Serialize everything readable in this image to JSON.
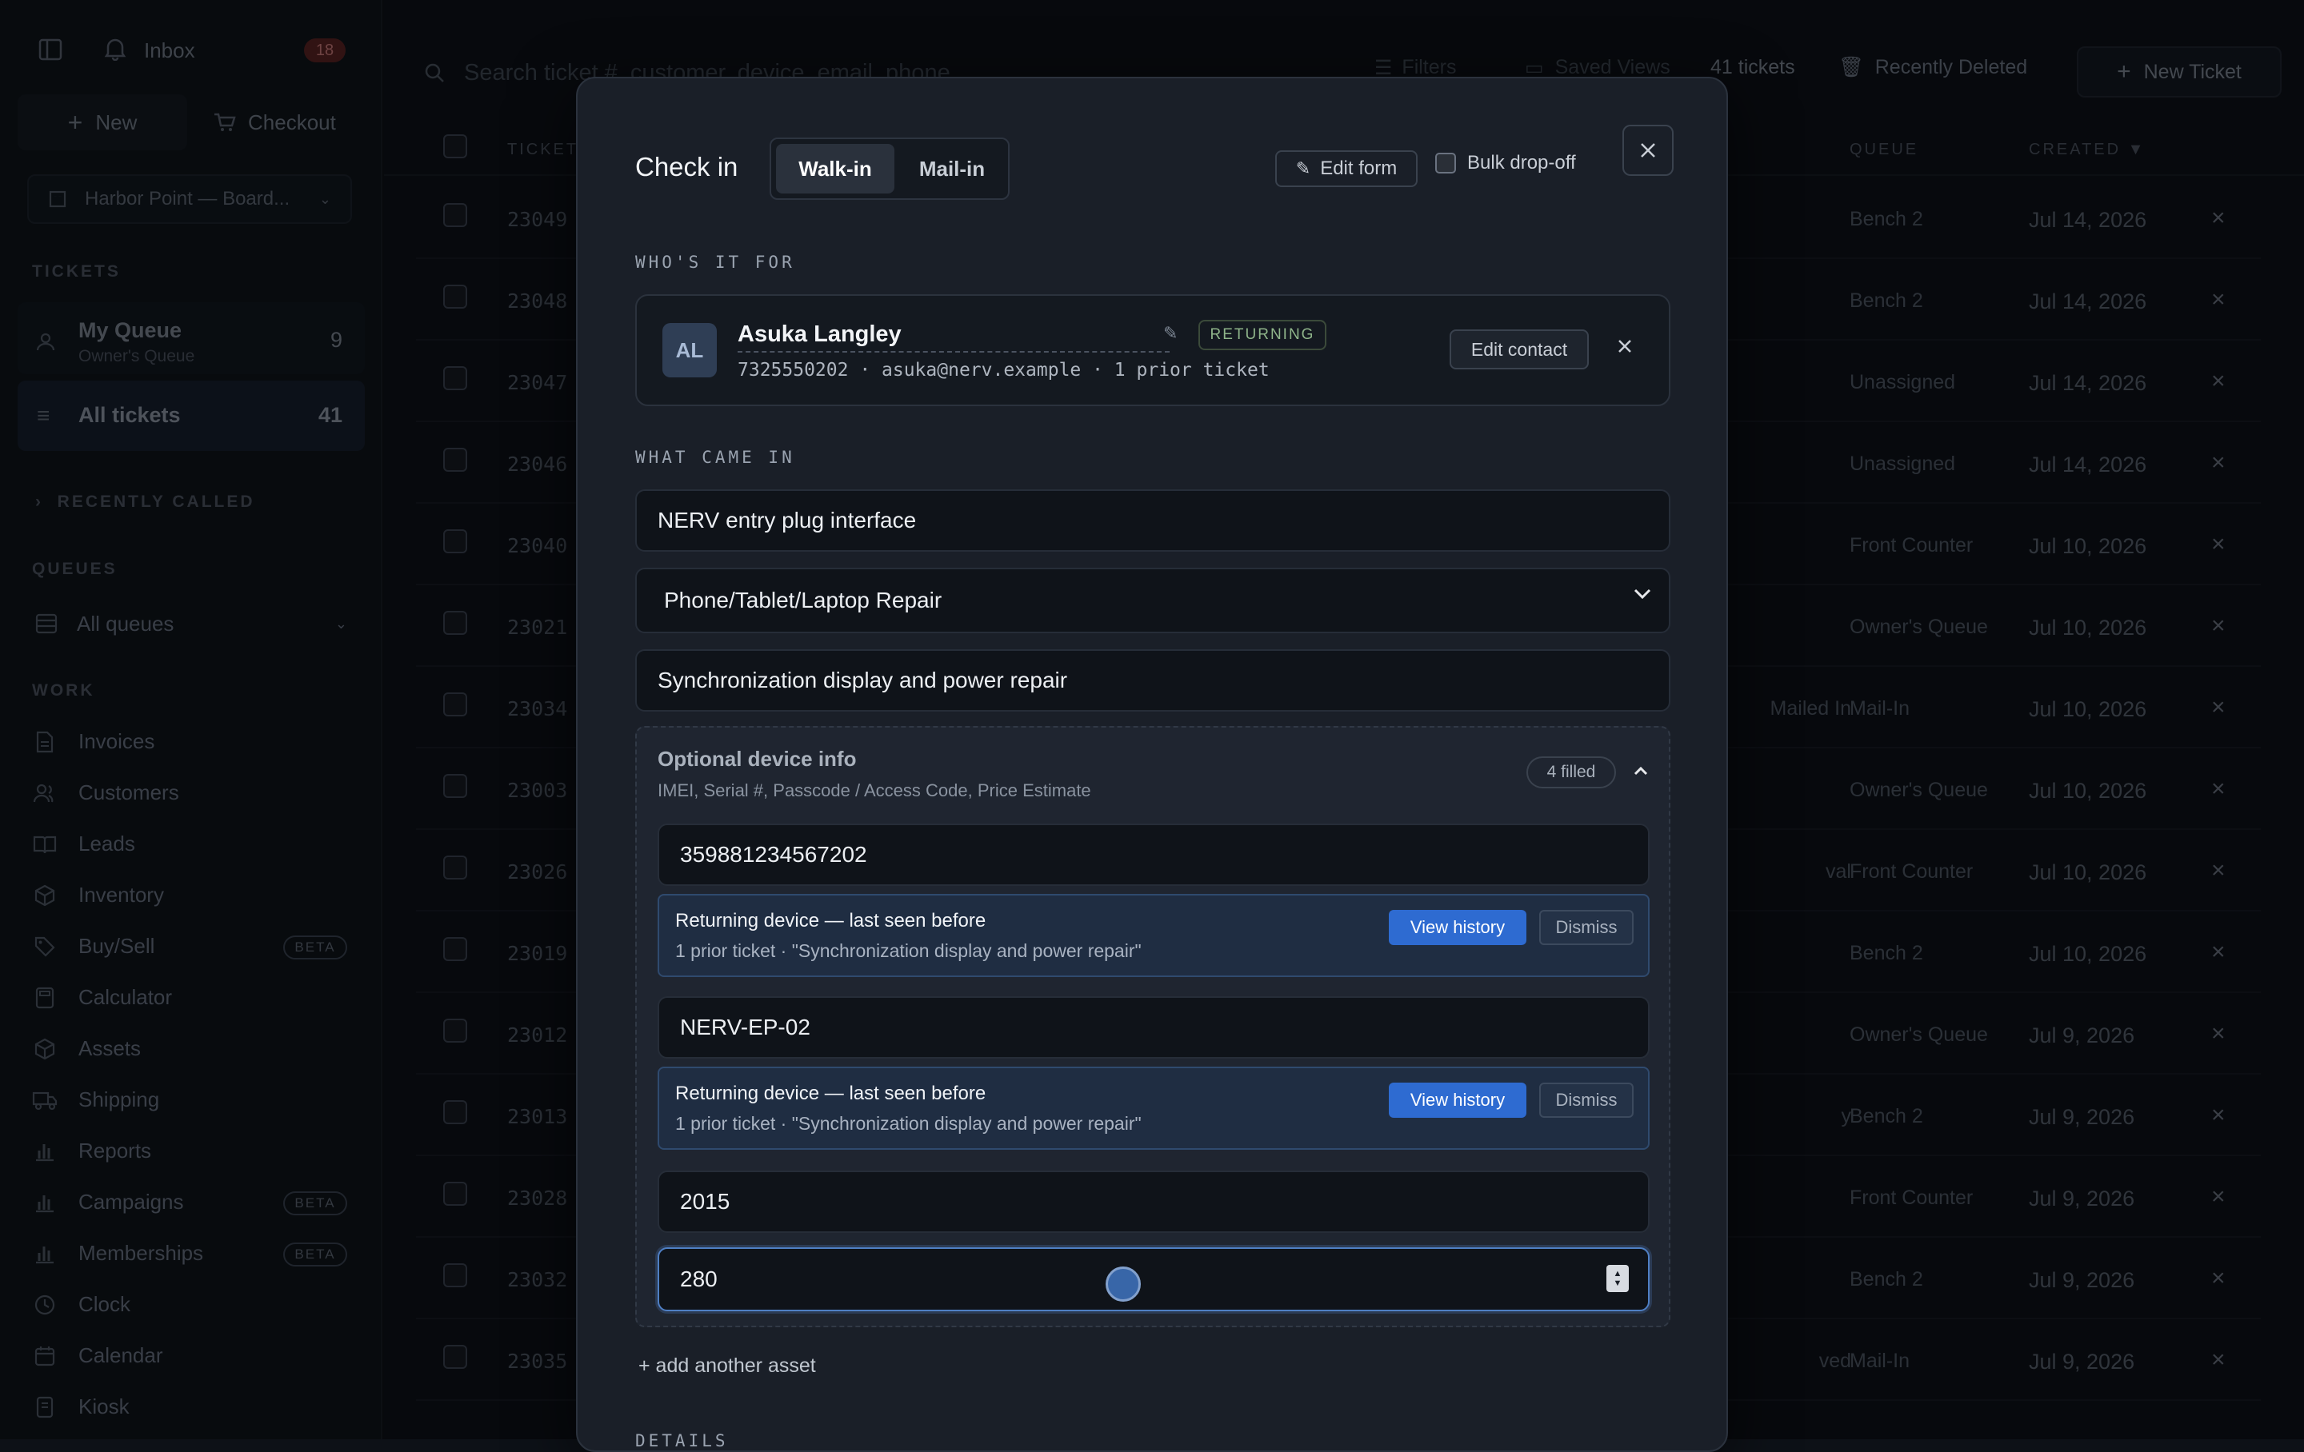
{
  "sidebar": {
    "inbox_label": "Inbox",
    "inbox_count": "18",
    "new_label": "New",
    "checkout_label": "Checkout",
    "location": "Harbor Point — Board...",
    "tickets_title": "TICKETS",
    "my_queue_label": "My Queue",
    "my_queue_sub": "Owner's Queue",
    "my_queue_count": "9",
    "all_tickets_label": "All tickets",
    "all_tickets_count": "41",
    "recently_called": "RECENTLY CALLED",
    "queues_title": "QUEUES",
    "all_queues": "All queues",
    "work_title": "WORK",
    "work_items": [
      {
        "label": "Invoices",
        "icon": "file-icon"
      },
      {
        "label": "Customers",
        "icon": "users-icon"
      },
      {
        "label": "Leads",
        "icon": "book-icon"
      },
      {
        "label": "Inventory",
        "icon": "box-icon"
      },
      {
        "label": "Buy/Sell",
        "icon": "tag-icon",
        "badge": "BETA"
      },
      {
        "label": "Calculator",
        "icon": "calculator-icon"
      },
      {
        "label": "Assets",
        "icon": "cube-icon"
      },
      {
        "label": "Shipping",
        "icon": "truck-icon"
      },
      {
        "label": "Reports",
        "icon": "bar-chart-icon"
      },
      {
        "label": "Campaigns",
        "icon": "bar-chart-icon",
        "badge": "BETA"
      },
      {
        "label": "Memberships",
        "icon": "bar-chart-icon",
        "badge": "BETA"
      },
      {
        "label": "Clock",
        "icon": "clock-icon"
      },
      {
        "label": "Calendar",
        "icon": "calendar-icon"
      },
      {
        "label": "Kiosk",
        "icon": "tablet-icon"
      }
    ]
  },
  "topbar": {
    "search_placeholder": "Search ticket #, customer, device, email, phone",
    "filters": "Filters",
    "saved_views": "Saved Views",
    "ticket_count": "41 tickets",
    "recently_deleted": "Recently Deleted",
    "new_ticket": "New Ticket"
  },
  "table": {
    "col_ticket": "TICKET",
    "col_queue": "QUEUE",
    "col_created": "CREATED ▼",
    "rows": [
      {
        "id": "23049",
        "mid": "",
        "queue": "Bench 2",
        "created": "Jul 14, 2026"
      },
      {
        "id": "23048",
        "mid": "",
        "queue": "Bench 2",
        "created": "Jul 14, 2026"
      },
      {
        "id": "23047",
        "mid": "",
        "queue": "Unassigned",
        "created": "Jul 14, 2026"
      },
      {
        "id": "23046",
        "mid": "",
        "queue": "Unassigned",
        "created": "Jul 14, 2026"
      },
      {
        "id": "23040",
        "mid": "",
        "queue": "Front Counter",
        "created": "Jul 10, 2026"
      },
      {
        "id": "23021",
        "mid": "",
        "queue": "Owner's Queue",
        "created": "Jul 10, 2026"
      },
      {
        "id": "23034",
        "mid": "Mailed In",
        "queue": "Mail-In",
        "created": "Jul 10, 2026"
      },
      {
        "id": "23003",
        "mid": "",
        "queue": "Owner's Queue",
        "created": "Jul 10, 2026"
      },
      {
        "id": "23026",
        "mid": "val",
        "queue": "Front Counter",
        "created": "Jul 10, 2026"
      },
      {
        "id": "23019",
        "mid": "",
        "queue": "Bench 2",
        "created": "Jul 10, 2026"
      },
      {
        "id": "23012",
        "mid": "",
        "queue": "Owner's Queue",
        "created": "Jul 9, 2026"
      },
      {
        "id": "23013",
        "mid": "y",
        "queue": "Bench 2",
        "created": "Jul 9, 2026"
      },
      {
        "id": "23028",
        "mid": "",
        "queue": "Front Counter",
        "created": "Jul 9, 2026"
      },
      {
        "id": "23032",
        "mid": "",
        "queue": "Bench 2",
        "created": "Jul 9, 2026"
      },
      {
        "id": "23035",
        "mid": "ved",
        "queue": "Mail-In",
        "created": "Jul 9, 2026"
      }
    ]
  },
  "modal": {
    "title": "Check in",
    "tab_walkin": "Walk-in",
    "tab_mailin": "Mail-in",
    "edit_form": "Edit form",
    "bulk_dropoff": "Bulk drop-off",
    "whos_it_for": "WHO'S IT FOR",
    "customer": {
      "initials": "AL",
      "name": "Asuka Langley",
      "badge": "RETURNING",
      "details": "7325550202 · asuka@nerv.example · 1 prior ticket",
      "edit_contact": "Edit contact"
    },
    "what_came_in": "WHAT CAME IN",
    "device_name": "NERV entry plug interface",
    "category": "Phone/Tablet/Laptop Repair",
    "issue": "Synchronization display and power repair",
    "optional": {
      "title": "Optional device info",
      "subtitle": "IMEI, Serial #, Passcode / Access Code, Price Estimate",
      "filled": "4 filled",
      "imei": "359881234567202",
      "serial": "NERV-EP-02",
      "passcode": "2015",
      "price": "280"
    },
    "alert": {
      "title": "Returning device — last seen before",
      "sub": "1 prior ticket · \"Synchronization display and power repair\"",
      "view_history": "View history",
      "dismiss": "Dismiss"
    },
    "add_asset": "+ add another asset",
    "details_title": "DETAILS"
  },
  "colors": {
    "accent": "#2e6bd1",
    "badge_red": "#7a2a2a",
    "returning": "#8fb58a"
  }
}
